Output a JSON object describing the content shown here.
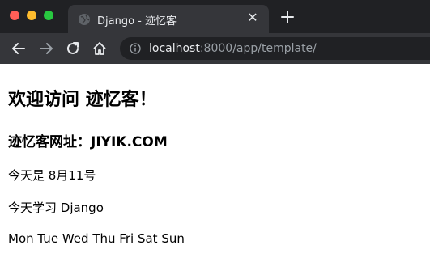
{
  "browser": {
    "tab": {
      "title": "Django - 迹忆客",
      "close_symbol": "✕"
    },
    "new_tab_symbol": "+",
    "address": {
      "host": "localhost",
      "rest": ":8000/app/template/"
    },
    "colors": {
      "tabstrip": "#202124",
      "toolbar": "#35363a",
      "omnibox": "#202124"
    },
    "icons": [
      "globe-icon",
      "close-icon",
      "plus-icon",
      "back-arrow-icon",
      "forward-arrow-icon",
      "reload-icon",
      "home-icon",
      "info-icon"
    ]
  },
  "page": {
    "heading": "欢迎访问 迹忆客！",
    "subheading": "迹忆客网址：JIYIK.COM",
    "date_line": "今天是 8月11号",
    "study_line": "今天学习 Django",
    "weekdays": [
      "Mon",
      "Tue",
      "Wed",
      "Thu",
      "Fri",
      "Sat",
      "Sun"
    ]
  }
}
